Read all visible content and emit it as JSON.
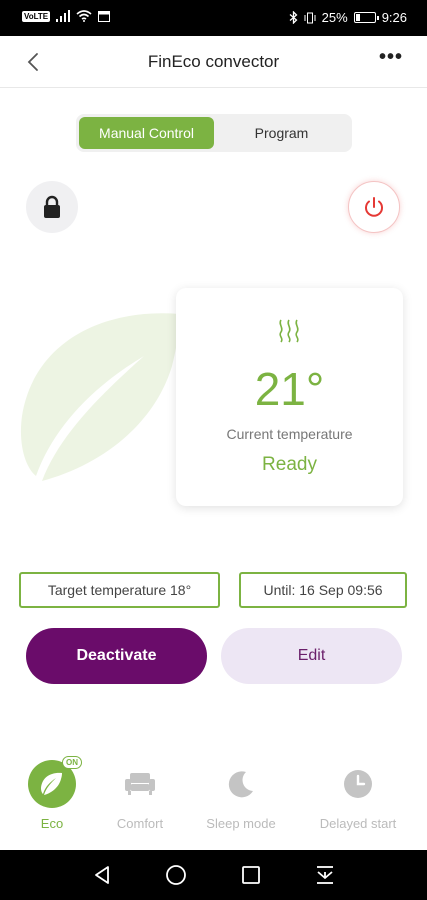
{
  "status_bar": {
    "carrier_chip": "VoLTE",
    "battery_text": "25%",
    "battery_level": 0.25,
    "time": "9:26"
  },
  "header": {
    "title": "FinEco convector"
  },
  "tabs": [
    {
      "label": "Manual Control",
      "active": true
    },
    {
      "label": "Program",
      "active": false
    }
  ],
  "temperature_card": {
    "value": "21°",
    "label": "Current temperature",
    "status": "Ready"
  },
  "info": {
    "target": "Target temperature 18°",
    "until": "Until: 16 Sep 09:56"
  },
  "actions": {
    "deactivate": "Deactivate",
    "edit": "Edit"
  },
  "modes": [
    {
      "label": "Eco",
      "icon": "leaf-icon",
      "active": true,
      "badge": "ON"
    },
    {
      "label": "Comfort",
      "icon": "armchair-icon",
      "active": false
    },
    {
      "label": "Sleep mode",
      "icon": "moon-icon",
      "active": false
    },
    {
      "label": "Delayed start",
      "icon": "clock-icon",
      "active": false
    }
  ],
  "colors": {
    "accent_green": "#7cb342",
    "deactivate_purple": "#6a0c6a",
    "edit_bg": "#ede6f4",
    "power_red": "#e53935"
  }
}
